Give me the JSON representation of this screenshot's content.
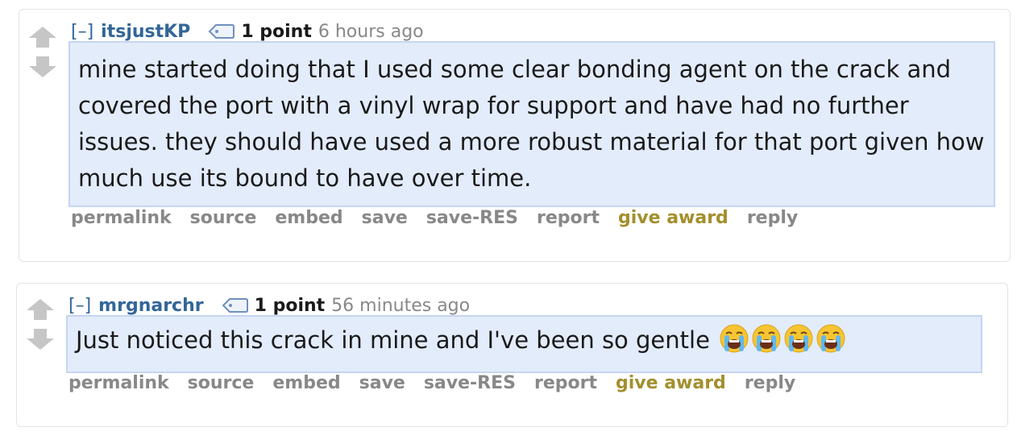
{
  "comments": [
    {
      "collapse_toggle": "[–]",
      "author": "itsjustKP",
      "score": "1 point",
      "time": "6 hours ago",
      "body": "mine started doing that I used some clear bonding agent on the crack and covered the port with a vinyl wrap for support and have had no further issues. they should have used a more robust material for that port given how much use its bound to have over time.",
      "buttons": {
        "permalink": "permalink",
        "source": "source",
        "embed": "embed",
        "save": "save",
        "save_res": "save-RES",
        "report": "report",
        "give_award": "give award",
        "reply": "reply"
      }
    },
    {
      "collapse_toggle": "[–]",
      "author": "mrgnarchr",
      "score": "1 point",
      "time": "56 minutes ago",
      "body": "Just noticed this crack in mine and I've been so gentle",
      "emoji": [
        "loudly-crying-face",
        "loudly-crying-face",
        "loudly-crying-face",
        "loudly-crying-face"
      ],
      "buttons": {
        "permalink": "permalink",
        "source": "source",
        "embed": "embed",
        "save": "save",
        "save_res": "save-RES",
        "report": "report",
        "give_award": "give award",
        "reply": "reply"
      }
    }
  ],
  "colors": {
    "username": "#336699",
    "meta": "#888888",
    "award": "#a38f2c",
    "body_bg": "#e3ecfb",
    "body_border": "#c5d5f2",
    "arrow": "#c6c6c6"
  },
  "icons": {
    "upvote": "upvote-arrow-icon",
    "downvote": "downvote-arrow-icon",
    "flair": "tag-icon"
  }
}
